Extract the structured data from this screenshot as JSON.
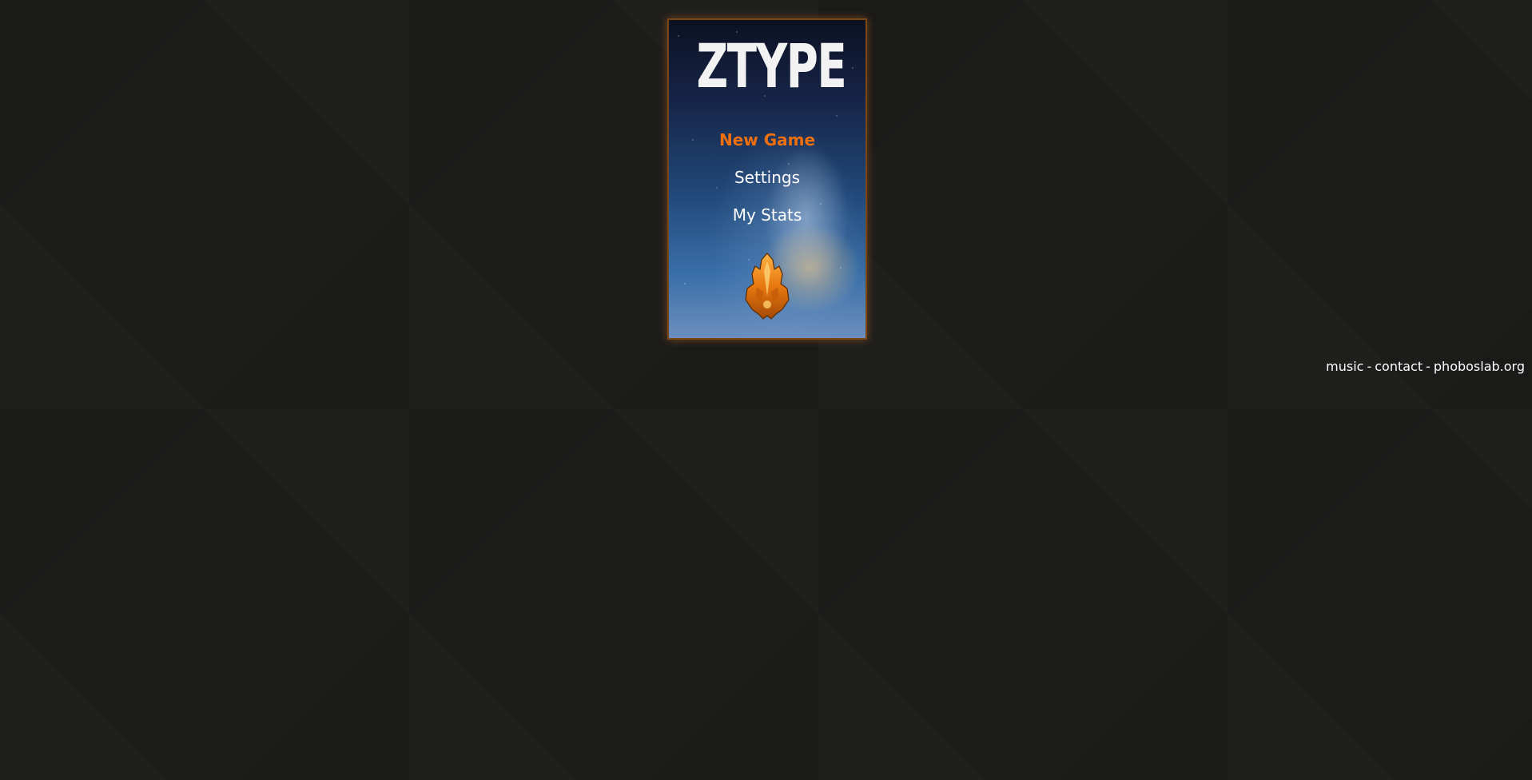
{
  "game": {
    "title": "ZTYPE",
    "menu": [
      {
        "label": "New Game",
        "active": true
      },
      {
        "label": "Settings",
        "active": false
      },
      {
        "label": "My Stats",
        "active": false
      }
    ],
    "ship_icon": "player-ship-icon"
  },
  "footer": {
    "links": [
      {
        "label": "music"
      },
      {
        "label": "contact"
      },
      {
        "label": "phoboslab.org"
      }
    ],
    "separator": "-"
  },
  "colors": {
    "background": "#1c1c1b",
    "accent": "#ee6f0e",
    "frame_border": "#7a4616",
    "text": "#ffffff"
  }
}
